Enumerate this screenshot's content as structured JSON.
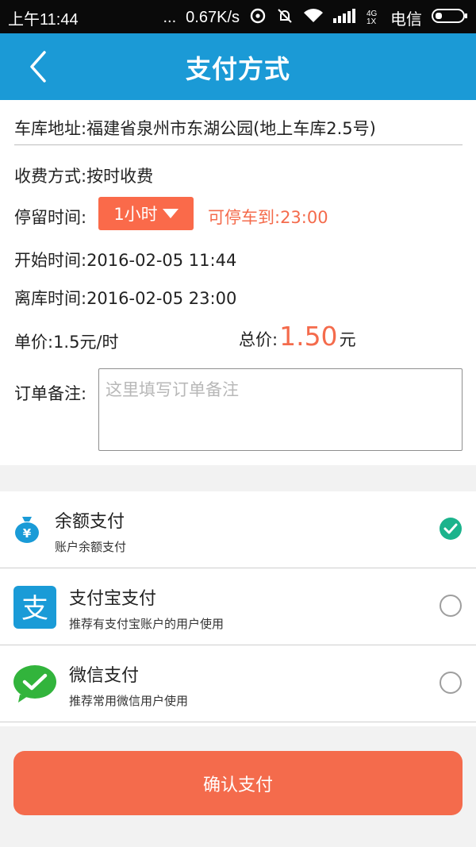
{
  "status_bar": {
    "time": "上午11:44",
    "dots": "...",
    "speed": "0.67K/s",
    "network_type": "4G 1X",
    "carrier": "电信"
  },
  "header": {
    "title": "支付方式",
    "back_icon": "back-arrow-icon",
    "background_color": "#1b9ad6"
  },
  "form": {
    "address": "车库地址:福建省泉州市东湖公园(地上车库2.5号)",
    "fee_mode": "收费方式:按时收费",
    "stay_label": "停留时间:",
    "stay_value": "1小时",
    "park_until": "可停车到:23:00",
    "start_time": "开始时间:2016-02-05 11:44",
    "leave_time": "离库时间:2016-02-05 23:00",
    "unit_price": "单价:1.5元/时",
    "total_label": "总价:",
    "total_amount": "1.50",
    "total_unit": "元",
    "note_label": "订单备注:",
    "note_placeholder": "这里填写订单备注",
    "accent_color": "#f46b4c"
  },
  "payments": [
    {
      "name": "余额支付",
      "desc": "账户余额支付",
      "icon": "money-bag-icon",
      "selected": true
    },
    {
      "name": "支付宝支付",
      "desc": "推荐有支付宝账户的用户使用",
      "icon": "alipay-icon",
      "selected": false
    },
    {
      "name": "微信支付",
      "desc": "推荐常用微信用户使用",
      "icon": "wechat-icon",
      "selected": false
    }
  ],
  "confirm_label": "确认支付",
  "selected_color": "#1bb38c"
}
